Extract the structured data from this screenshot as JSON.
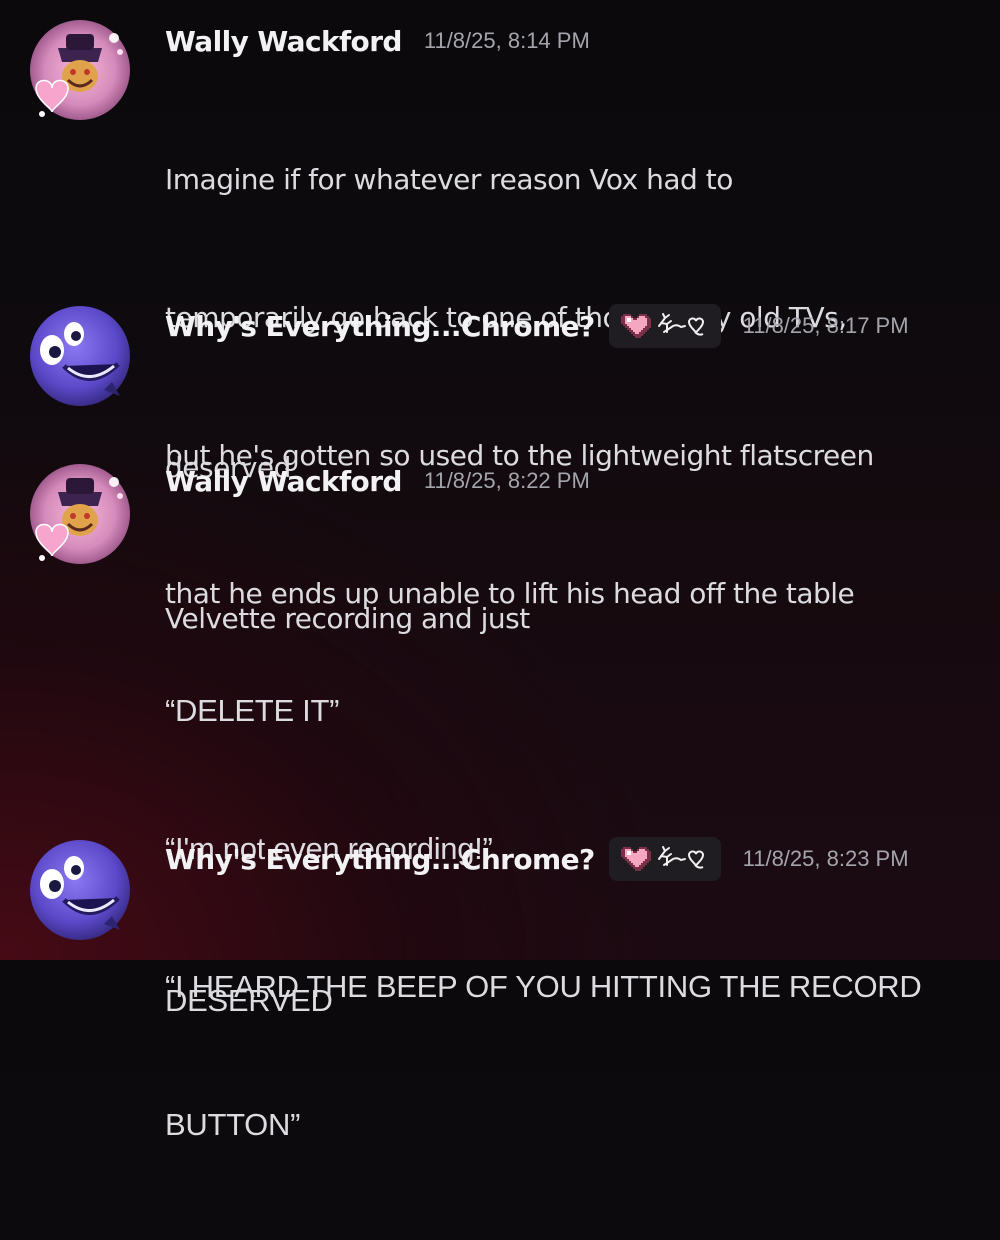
{
  "messages": [
    {
      "author": "Wally Wackford",
      "timestamp": "11/8/25, 8:14 PM",
      "avatar_icon": "pink-overlord-avatar-icon",
      "lines": [
        "Imagine if for whatever reason Vox had to",
        "temporarily go back to one of those bulky old TVs,",
        "but he's gotten so used to the lightweight flatscreen",
        "that he ends up unable to lift his head off the table"
      ]
    },
    {
      "author": "Why's Everything...Chrome?",
      "timestamp": "11/8/25, 8:17 PM",
      "avatar_icon": "blue-tv-face-avatar-icon",
      "tag_icons": [
        "pixel-heart-icon",
        "deer-heart-glyph-icon"
      ],
      "lines": [
        "deserved"
      ]
    },
    {
      "author": "Wally Wackford",
      "timestamp": "11/8/25, 8:22 PM",
      "avatar_icon": "pink-overlord-avatar-icon",
      "lines": [
        "Velvette recording and just",
        "",
        "“DELETE IT”",
        "“I'm not even recording!”",
        "“I HEARD THE BEEP OF YOU HITTING THE RECORD",
        "BUTTON”"
      ]
    },
    {
      "author": "Why's Everything...Chrome?",
      "timestamp": "11/8/25, 8:23 PM",
      "avatar_icon": "blue-tv-face-avatar-icon",
      "tag_icons": [
        "pixel-heart-icon",
        "deer-heart-glyph-icon"
      ],
      "lines": [
        "DESERVED"
      ]
    }
  ],
  "colors": {
    "username": "#f2f2f4",
    "text": "#dcdce0",
    "timestamp": "#a4a4ac",
    "tag_background": "#1f1d22"
  }
}
